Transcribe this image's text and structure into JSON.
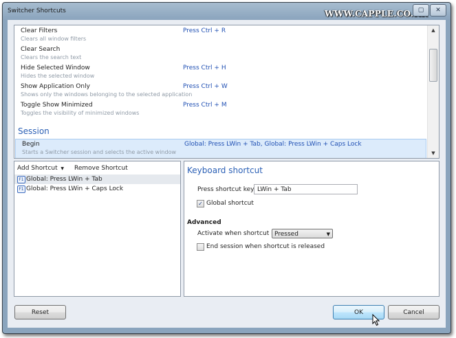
{
  "window": {
    "title": "Switcher Shortcuts",
    "watermark": "WWW.CAPPLE.CO.KR"
  },
  "shortcuts_list": {
    "items": [
      {
        "title": "Clear Filters",
        "description": "Clears all window filters",
        "keys": "Press Ctrl + R"
      },
      {
        "title": "Clear Search",
        "description": "Clears the search text",
        "keys": ""
      },
      {
        "title": "Hide Selected Window",
        "description": "Hides the selected window",
        "keys": "Press Ctrl + H"
      },
      {
        "title": "Show Application Only",
        "description": "Shows only the windows belonging to the selected application",
        "keys": "Press Ctrl + W"
      },
      {
        "title": "Toggle Show Minimized",
        "description": "Toggles the visibility of minimized windows",
        "keys": "Press Ctrl + M"
      }
    ],
    "section_title": "Session",
    "session_items": [
      {
        "title": "Begin",
        "description": "Starts a Switcher session and selects the active window",
        "keys": "Global: Press LWin + Tab, Global: Press LWin + Caps Lock"
      }
    ]
  },
  "shortcut_toolbar": {
    "add_label": "Add Shortcut",
    "remove_label": "Remove Shortcut"
  },
  "shortcut_entries": [
    {
      "key_badge": "F1",
      "label": "Global: Press LWin + Tab"
    },
    {
      "key_badge": "F1",
      "label": "Global: Press LWin + Caps Lock"
    }
  ],
  "keyboard_shortcut": {
    "title": "Keyboard shortcut",
    "keys_label": "Press shortcut keys:",
    "keys_value": "LWin + Tab",
    "global_label": "Global shortcut",
    "global_checked": true,
    "advanced_title": "Advanced",
    "activate_label": "Activate when shortcut is:",
    "activate_value": "Pressed",
    "end_session_label": "End session when shortcut is released",
    "end_session_checked": false
  },
  "buttons": {
    "reset": "Reset",
    "ok": "OK",
    "cancel": "Cancel"
  },
  "colors": {
    "accent": "#2a5fb5",
    "key_text": "#1f4fb3",
    "selection": "#dcebfb"
  }
}
